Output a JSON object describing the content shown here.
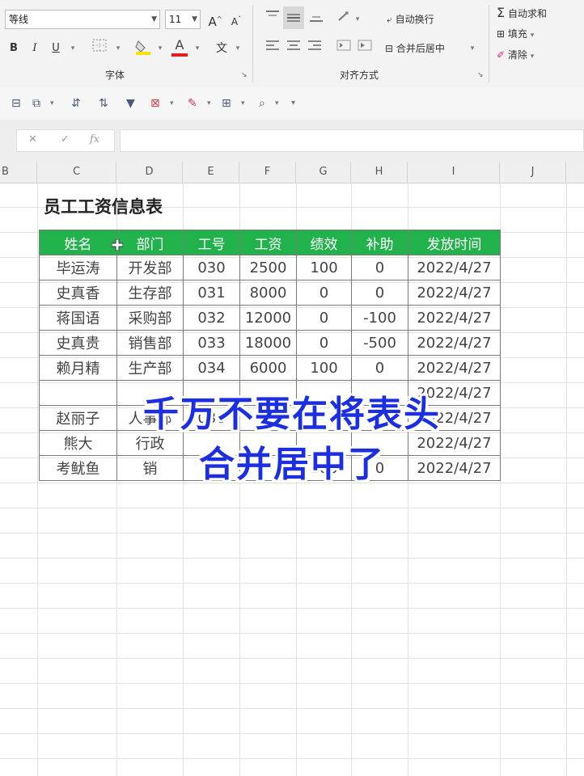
{
  "ribbon": {
    "font_name": "等线",
    "font_size": "11",
    "grow_font": "A",
    "shrink_font": "A",
    "bold": "B",
    "italic": "I",
    "underline": "U",
    "font_color_letter": "A",
    "wen": "文",
    "font_group_label": "字体",
    "align_group_label": "对齐方式",
    "wrap_text": "自动换行",
    "merge_center": "合并后居中",
    "autosum": "自动求和",
    "fill": "填充",
    "clear": "清除",
    "sigma": "Σ"
  },
  "formula_bar": {
    "cancel": "✕",
    "confirm": "✓",
    "fx": "fx",
    "value": ""
  },
  "columns": [
    "B",
    "C",
    "D",
    "E",
    "F",
    "G",
    "H",
    "I",
    "J"
  ],
  "sheet": {
    "title": "员工工资信息表",
    "headers": [
      "姓名",
      "部门",
      "工号",
      "工资",
      "绩效",
      "补助",
      "发放时间"
    ],
    "rows": [
      [
        "毕运涛",
        "开发部",
        "030",
        "2500",
        "100",
        "0",
        "2022/4/27"
      ],
      [
        "史真香",
        "生存部",
        "031",
        "8000",
        "0",
        "0",
        "2022/4/27"
      ],
      [
        "蒋国语",
        "采购部",
        "032",
        "12000",
        "0",
        "-100",
        "2022/4/27"
      ],
      [
        "史真贵",
        "销售部",
        "033",
        "18000",
        "0",
        "-500",
        "2022/4/27"
      ],
      [
        "赖月精",
        "生产部",
        "034",
        "6000",
        "100",
        "0",
        "2022/4/27"
      ],
      [
        "",
        "",
        "",
        "",
        "",
        "",
        "2022/4/27"
      ],
      [
        "赵丽子",
        "人事部",
        "036",
        "",
        "",
        "",
        "2022/4/27"
      ],
      [
        "熊大",
        "行政",
        "",
        "",
        "",
        "",
        "2022/4/27"
      ],
      [
        "考鱿鱼",
        "销",
        "",
        "",
        "100",
        "0",
        "2022/4/27"
      ]
    ]
  },
  "overlay": {
    "line1": "千万不要在将表头",
    "line2": "合并居中了"
  },
  "colors": {
    "header_fill": "#22b24c",
    "overlay_text": "#1c2fe0"
  }
}
